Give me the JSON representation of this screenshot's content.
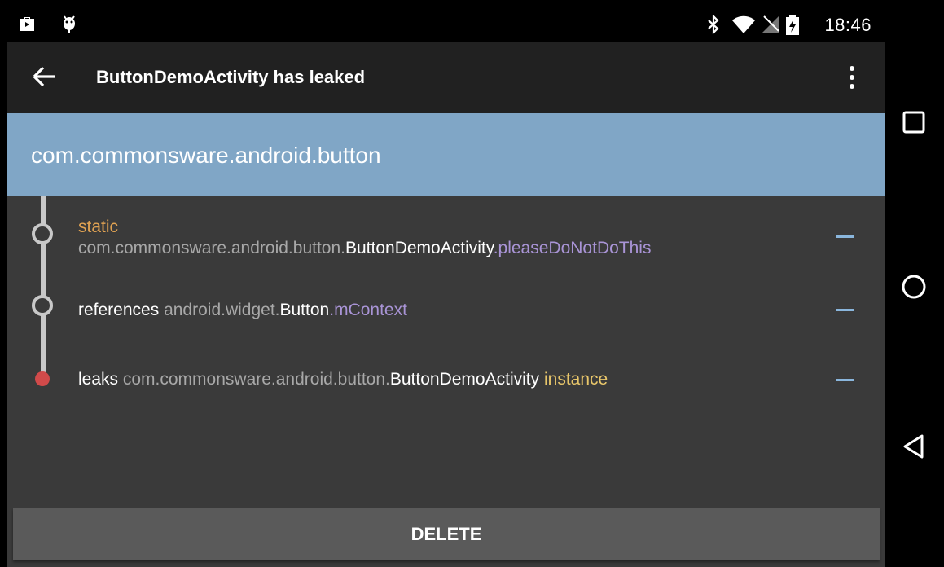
{
  "status_bar": {
    "time": "18:46",
    "icons": [
      "shopping-bag-icon",
      "android-debug-icon",
      "bluetooth-icon",
      "wifi-icon",
      "no-signal-icon",
      "battery-charging-icon"
    ]
  },
  "app_bar": {
    "title": "ButtonDemoActivity has leaked",
    "back_icon": "arrow-back-icon",
    "overflow_icon": "more-vert-icon"
  },
  "header": {
    "package": "com.commonsware.android.button"
  },
  "trace": [
    {
      "kind": "static",
      "prefix": "com.commonsware.android.button.",
      "class": "ButtonDemoActivity",
      "dot": ".",
      "field": "pleaseDoNotDoThis"
    },
    {
      "kind": "references",
      "prefix": "android.widget.",
      "class": "Button",
      "dot": ".",
      "field": "mContext"
    },
    {
      "kind": "leaks",
      "prefix": "com.commonsware.android.button.",
      "class": "ButtonDemoActivity",
      "suffix": "instance"
    }
  ],
  "footer": {
    "delete_label": "DELETE"
  },
  "nav_bar": {
    "buttons": [
      "recents-icon",
      "home-icon",
      "back-triangle-icon"
    ]
  },
  "colors": {
    "header_bg": "#80a6c6",
    "app_bar_bg": "#212121",
    "content_bg": "#3a3a3a",
    "accent_purple": "#a994d6",
    "accent_orange": "#e0a252",
    "accent_yellow": "#e8c66a",
    "leak_red": "#d14a4a",
    "dash_blue": "#8ab6dc"
  }
}
